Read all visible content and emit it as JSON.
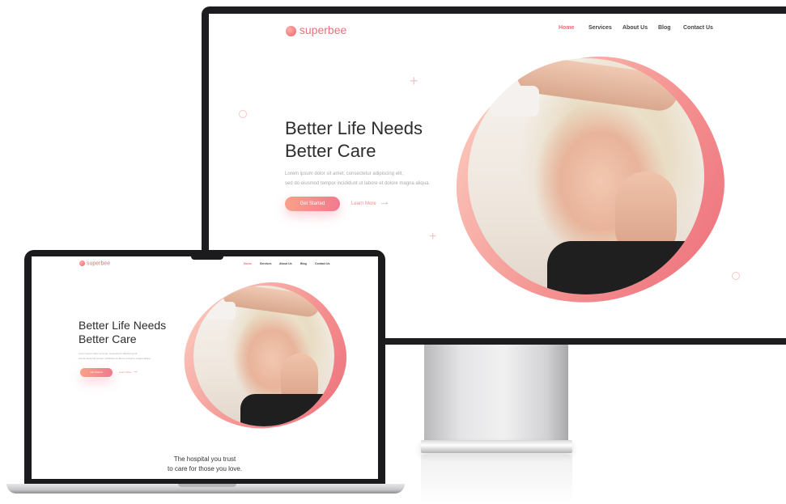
{
  "site": {
    "logo_text": "superbee",
    "nav": [
      {
        "label": "Home",
        "active": true
      },
      {
        "label": "Services",
        "active": false
      },
      {
        "label": "About Us",
        "active": false
      },
      {
        "label": "Blog",
        "active": false
      },
      {
        "label": "Contact Us",
        "active": false
      }
    ],
    "hero": {
      "title_line1": "Better Life Needs",
      "title_line2": "Better Care",
      "paragraph_line1": "Lorem ipsum dolor sit amet, consectetur adipiscing elit,",
      "paragraph_line2": "sed do eiusmod tempor incididunt ut labore et dolore magna aliqua.",
      "primary_button": "Get Started",
      "secondary_link": "Learn More",
      "secondary_arrow": "⟶"
    },
    "section_heading_line1": "The hospital you trust",
    "section_heading_line2": "to care for those you love."
  },
  "colors": {
    "accent": "#ee6f78",
    "button_start": "#f9a18a",
    "button_end": "#f07a8e",
    "bezel": "#1d1d1f"
  },
  "icons": {
    "logo_mark": "superbee-logo-icon",
    "plus": "plus-decoration-icon",
    "circle": "circle-decoration-icon",
    "arrow": "arrow-right-icon"
  }
}
